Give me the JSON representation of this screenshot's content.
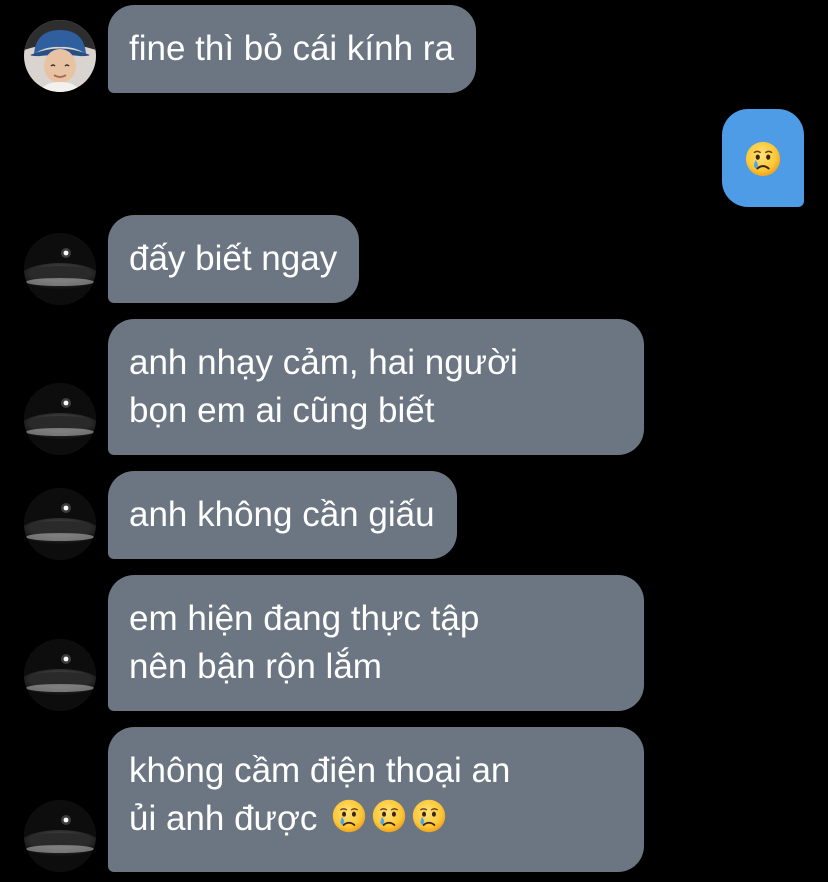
{
  "chat": {
    "messages": [
      {
        "id": "m1",
        "side": "incoming",
        "avatar": "profile-photo",
        "lines": [
          "fine thì bỏ cái kính ra"
        ]
      },
      {
        "id": "m2",
        "side": "outgoing",
        "emojis": [
          "crying-face"
        ]
      },
      {
        "id": "m3",
        "side": "incoming",
        "avatar": "dark-hat-avatar",
        "lines": [
          "đấy biết ngay"
        ]
      },
      {
        "id": "m4",
        "side": "incoming",
        "avatar": "dark-hat-avatar",
        "lines": [
          "anh nhạy cảm, hai người",
          "bọn em ai cũng biết"
        ]
      },
      {
        "id": "m5",
        "side": "incoming",
        "avatar": "dark-hat-avatar",
        "lines": [
          "anh không cần giấu"
        ]
      },
      {
        "id": "m6",
        "side": "incoming",
        "avatar": "dark-hat-avatar",
        "lines": [
          "em hiện đang thực tập",
          "nên bận rộn lắm"
        ]
      },
      {
        "id": "m7",
        "side": "incoming",
        "avatar": "dark-hat-avatar",
        "lines": [
          "không cầm điện thoại an",
          "ủi anh được"
        ],
        "emojis": [
          "crying-face",
          "crying-face",
          "crying-face"
        ]
      }
    ]
  },
  "colors": {
    "background": "#000000",
    "incoming_bubble": "#6b7682",
    "outgoing_bubble": "#4e9be6",
    "text": "#ffffff"
  }
}
